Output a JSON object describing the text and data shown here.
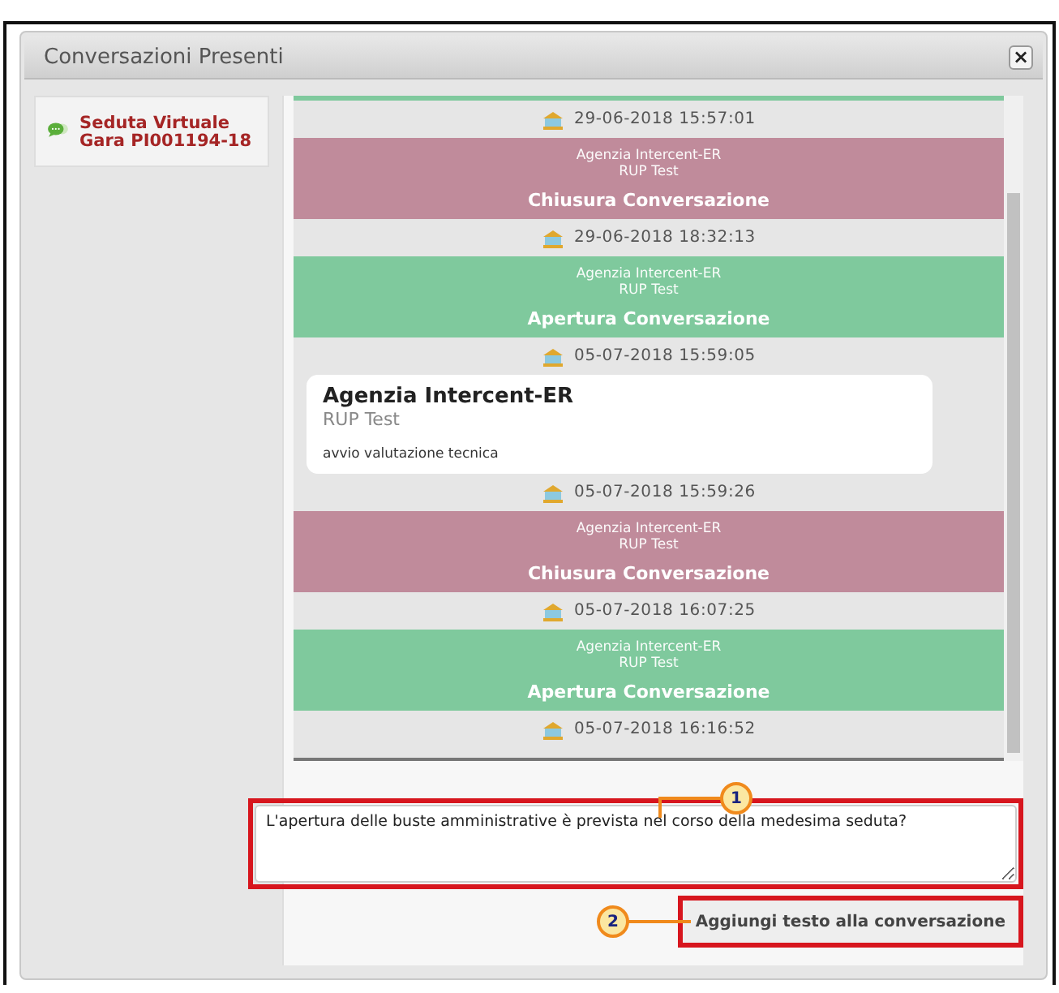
{
  "dialog": {
    "title": "Conversazioni Presenti",
    "close": "×"
  },
  "sidebar": {
    "items": [
      {
        "label": "Seduta Virtuale Gara PI001194-18",
        "selected": true
      }
    ]
  },
  "messages": [
    {
      "kind": "timestamp",
      "text": "29-06-2018 15:57:01"
    },
    {
      "kind": "closing",
      "sender": "Agenzia Intercent-ER",
      "role": "RUP Test",
      "text": "Chiusura Conversazione"
    },
    {
      "kind": "timestamp",
      "text": "29-06-2018 18:32:13"
    },
    {
      "kind": "opening",
      "sender": "Agenzia Intercent-ER",
      "role": "RUP Test",
      "text": "Apertura Conversazione"
    },
    {
      "kind": "timestamp",
      "text": "05-07-2018 15:59:05"
    },
    {
      "kind": "message",
      "sender": "Agenzia Intercent-ER",
      "role": "RUP Test",
      "text": "avvio valutazione tecnica"
    },
    {
      "kind": "timestamp",
      "text": "05-07-2018 15:59:26"
    },
    {
      "kind": "closing",
      "sender": "Agenzia Intercent-ER",
      "role": "RUP Test",
      "text": "Chiusura Conversazione"
    },
    {
      "kind": "timestamp",
      "text": "05-07-2018 16:07:25"
    },
    {
      "kind": "opening",
      "sender": "Agenzia Intercent-ER",
      "role": "RUP Test",
      "text": "Apertura Conversazione"
    },
    {
      "kind": "timestamp",
      "text": "05-07-2018 16:16:52"
    }
  ],
  "compose": {
    "value": "L'apertura delle buste amministrative è prevista nel corso della medesima seduta?"
  },
  "send_button": "Aggiungi testo alla conversazione",
  "callouts": [
    "1",
    "2"
  ]
}
